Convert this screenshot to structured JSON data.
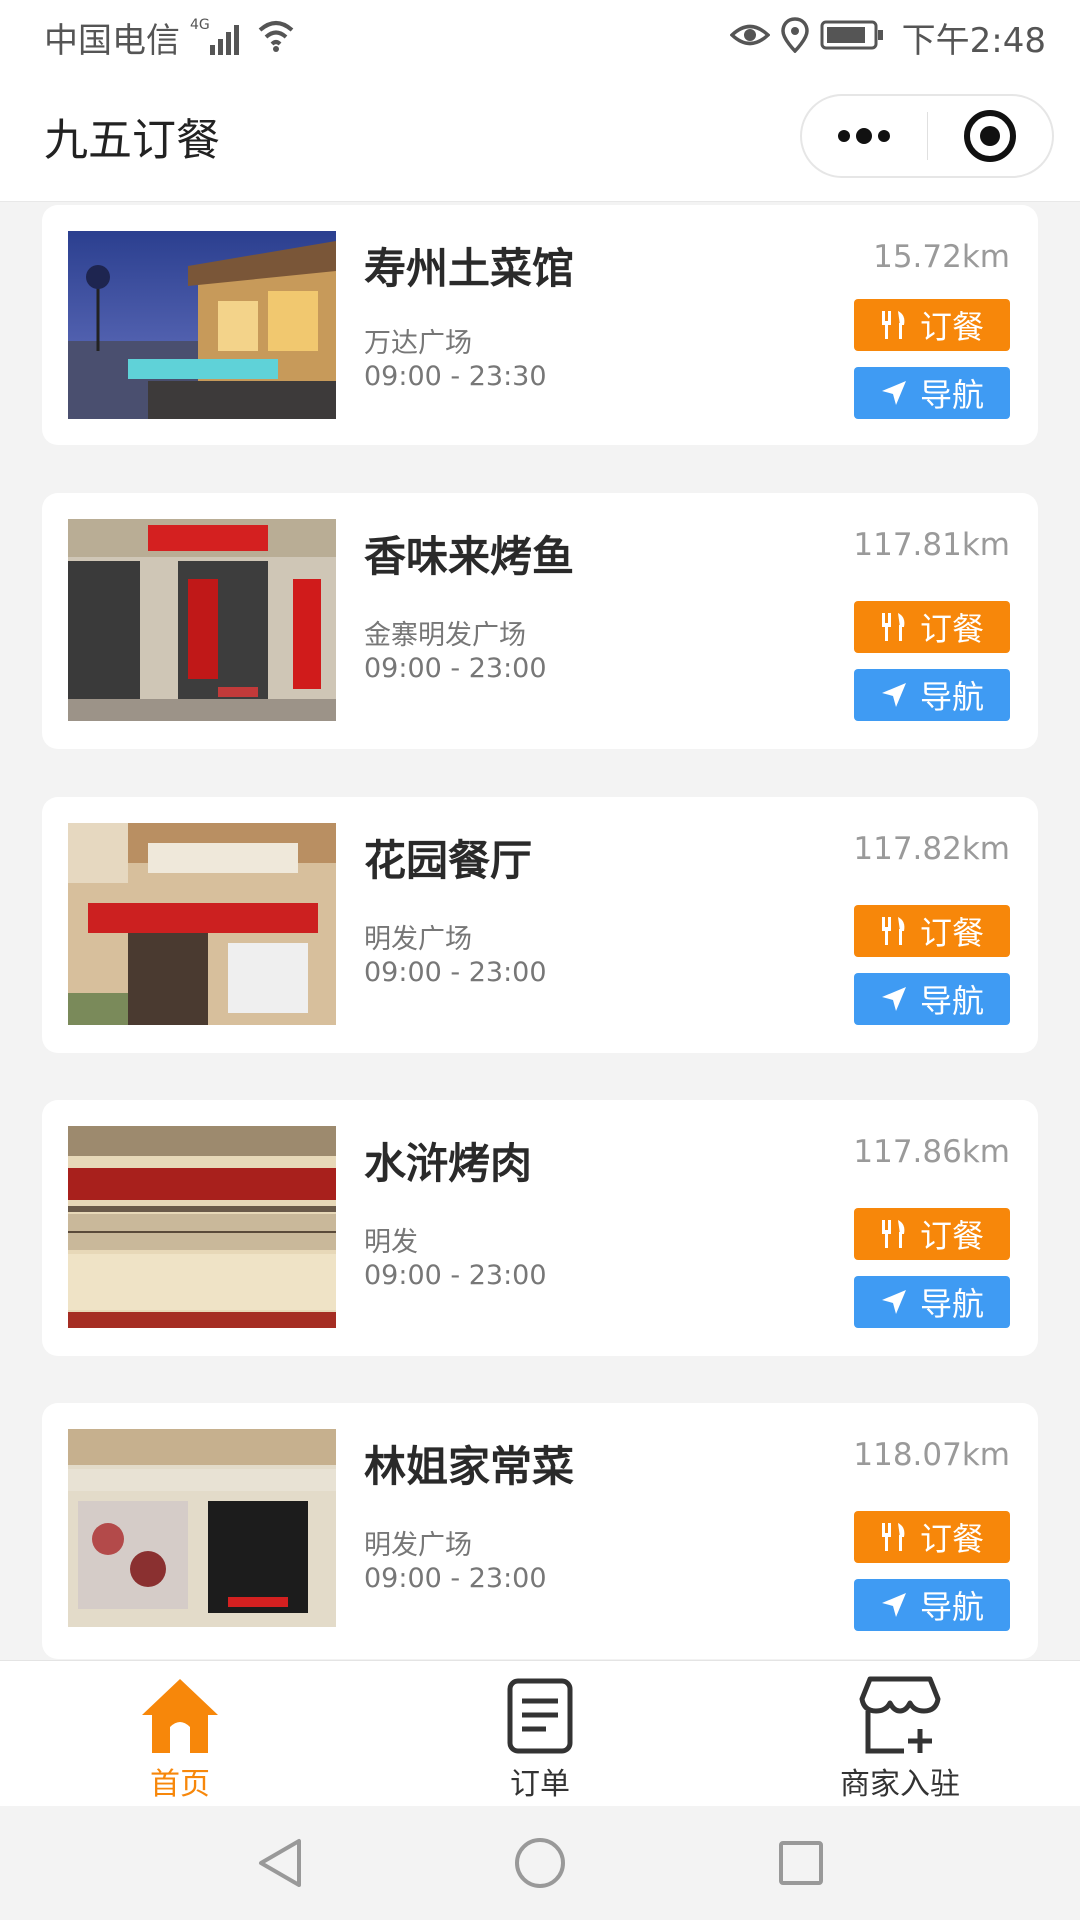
{
  "status_bar": {
    "carrier": "中国电信",
    "network": "4G",
    "time": "下午2:48"
  },
  "header": {
    "title": "九五订餐"
  },
  "restaurants": [
    {
      "name": "寿州土菜馆",
      "location": "万达广场",
      "hours": "09:00 - 23:30",
      "distance": "15.72km"
    },
    {
      "name": "香味来烤鱼",
      "location": "金寨明发广场",
      "hours": "09:00 - 23:00",
      "distance": "117.81km"
    },
    {
      "name": "花园餐厅",
      "location": "明发广场",
      "hours": "09:00 - 23:00",
      "distance": "117.82km"
    },
    {
      "name": "水浒烤肉",
      "location": "明发",
      "hours": "09:00 - 23:00",
      "distance": "117.86km"
    },
    {
      "name": "林姐家常菜",
      "location": "明发广场",
      "hours": "09:00 - 23:00",
      "distance": "118.07km"
    }
  ],
  "buttons": {
    "order": "订餐",
    "navigate": "导航"
  },
  "tabbar": {
    "tabs": [
      {
        "label": "首页",
        "icon": "home-icon",
        "active": true
      },
      {
        "label": "订单",
        "icon": "order-list-icon",
        "active": false
      },
      {
        "label": "商家入驻",
        "icon": "merchant-store-icon",
        "active": false
      }
    ]
  },
  "colors": {
    "accent_orange": "#f7870a",
    "nav_blue": "#3f9bf3",
    "inactive_tab": "#333333"
  }
}
